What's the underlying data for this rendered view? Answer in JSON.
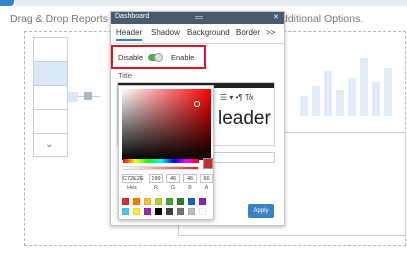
{
  "background": {
    "hint_left": "Drag & Drop Reports to D",
    "hint_right": "dditional Options.",
    "chevron": "⌄"
  },
  "dialog": {
    "title": "Dashboard",
    "close": "✕",
    "tabs": [
      "Header",
      "Shadow",
      "Background",
      "Border",
      ">>"
    ],
    "active_tab": "Header",
    "toggle": {
      "off_label": "Disable",
      "on_label": "Enable",
      "state": "on"
    },
    "title_label": "Title",
    "editor_tools": "☰ ▾  •¶  T̸x",
    "editor_text": "leader",
    "apply_label": "Apply"
  },
  "color_picker": {
    "hex_value": "C72E2E",
    "r": "199",
    "g": "46",
    "b": "46",
    "a": "66",
    "labels": {
      "hex": "Hex",
      "r": "R",
      "g": "G",
      "b": "B",
      "a": "A"
    },
    "selected_color": "#c72e2e",
    "swatches_row1": [
      "#d32f2f",
      "#f57c00",
      "#fbc02d",
      "#c0ca33",
      "#43a047",
      "#2e7d32",
      "#1565c0",
      "#8e24aa"
    ],
    "swatches_row2": [
      "#4fc3f7",
      "#ffeb3b",
      "#9c27b0",
      "#000000",
      "#424242",
      "#757575",
      "#bdbdbd",
      "#ffffff"
    ]
  },
  "colors": {
    "accent": "#3b82c4",
    "highlight_box": "#d8182a",
    "toggle_on": "#4caf50"
  }
}
